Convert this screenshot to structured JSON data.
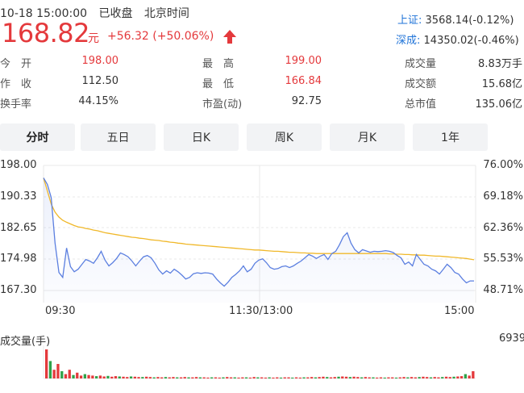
{
  "status": {
    "datetime": "10-18 15:00:00",
    "state": "已收盘",
    "tz": "北京时间"
  },
  "quote": {
    "price": "168.82",
    "unit": "元",
    "change": "+56.32 (+50.06%)"
  },
  "indices": [
    {
      "name": "上证:",
      "value": "3568.14(-0.12%)"
    },
    {
      "name": "深成:",
      "value": "14350.02(-0.46%)"
    }
  ],
  "stats": {
    "open_label": "今　开",
    "open": "198.00",
    "prev_label": "作　收",
    "prev": "112.50",
    "turnover_label": "换手率",
    "turnover": "44.15%",
    "high_label": "最　高",
    "high": "199.00",
    "low_label": "最　低",
    "low": "166.84",
    "pe_label": "市盈(动)",
    "pe": "92.75",
    "vol_label": "成交量",
    "vol": "8.83万手",
    "amount_label": "成交额",
    "amount": "15.68亿",
    "mcap_label": "总市值",
    "mcap": "135.06亿"
  },
  "tabs": [
    "分时",
    "五日",
    "日K",
    "周K",
    "月K",
    "1年"
  ],
  "colors": {
    "up": "#e4393c",
    "price_line": "#5b7fe0",
    "avg_line": "#f0b82a",
    "blue": "#1f73d8"
  },
  "chart_data": {
    "type": "line",
    "x_ticks": [
      "09:30",
      "11:30/13:00",
      "15:00"
    ],
    "y_ticks_left": [
      "198.00",
      "190.33",
      "182.65",
      "174.98",
      "167.30"
    ],
    "y_ticks_right": [
      "76.00%",
      "69.18%",
      "62.36%",
      "55.53%",
      "48.71%"
    ],
    "ylim": [
      163.46,
      201.84
    ],
    "series": [
      {
        "values": [
          198.0,
          196.0,
          192.0,
          178.0,
          169.0,
          167.5,
          176.5,
          170.8,
          169.2,
          170.0,
          171.5,
          173.0,
          172.5,
          171.8,
          173.5,
          175.5,
          172.8,
          171.0,
          172.0,
          173.3,
          175.0,
          174.5,
          173.8,
          172.5,
          171.0,
          172.5,
          173.8,
          174.2,
          173.5,
          171.8,
          169.8,
          168.5,
          169.5,
          168.8,
          170.0,
          169.2,
          168.2,
          167.0,
          167.5,
          168.6,
          168.9,
          168.7,
          168.9,
          168.8,
          168.5,
          167.0,
          165.8,
          164.8,
          166.0,
          167.5,
          168.4,
          169.5,
          171.0,
          169.2,
          170.0,
          171.8,
          172.8,
          173.2,
          172.0,
          170.5,
          170.0,
          170.2,
          170.8,
          171.0,
          170.5,
          171.0,
          171.8,
          172.5,
          173.5,
          174.5,
          174.0,
          173.3,
          174.0,
          174.5,
          173.0,
          174.8,
          175.5,
          177.5,
          180.0,
          181.2,
          178.0,
          176.0,
          175.0,
          176.0,
          175.6,
          175.2,
          175.5,
          175.4,
          175.5,
          175.7,
          175.5,
          175.1,
          174.2,
          173.5,
          171.5,
          172.2,
          171.0,
          174.5,
          173.0,
          171.5,
          171.0,
          170.0,
          169.5,
          168.5,
          170.0,
          171.5,
          170.5,
          169.0,
          168.5,
          167.0,
          165.8,
          166.4,
          166.4
        ]
      },
      {
        "values": [
          198.0,
          194.0,
          190.0,
          187.5,
          186.0,
          185.0,
          184.4,
          183.9,
          183.4,
          183.0,
          182.8,
          182.5,
          182.3,
          182.0,
          181.8,
          181.5,
          181.2,
          181.0,
          180.8,
          180.6,
          180.4,
          180.2,
          180.0,
          179.8,
          179.7,
          179.5,
          179.4,
          179.2,
          179.0,
          178.9,
          178.8,
          178.6,
          178.5,
          178.3,
          178.2,
          178.0,
          177.9,
          177.7,
          177.6,
          177.5,
          177.4,
          177.3,
          177.2,
          177.1,
          177.0,
          176.9,
          176.8,
          176.7,
          176.6,
          176.5,
          176.4,
          176.3,
          176.2,
          176.1,
          176.0,
          175.9,
          175.9,
          175.8,
          175.7,
          175.6,
          175.5,
          175.5,
          175.4,
          175.3,
          175.2,
          175.2,
          175.1,
          175.0,
          175.0,
          174.9,
          174.9,
          174.8,
          174.8,
          174.8,
          174.8,
          174.8,
          174.8,
          174.8,
          174.8,
          174.8,
          174.8,
          174.8,
          174.8,
          174.8,
          174.8,
          174.8,
          174.8,
          174.8,
          174.8,
          174.8,
          174.7,
          174.7,
          174.6,
          174.6,
          174.5,
          174.5,
          174.4,
          174.4,
          174.3,
          174.3,
          174.2,
          174.1,
          174.0,
          174.0,
          173.9,
          173.8,
          173.7,
          173.6,
          173.5,
          173.4,
          173.3,
          173.1,
          172.9
        ]
      }
    ],
    "volume_label": "成交量(手)",
    "volume_max": "6939",
    "volume_scale": [
      1.0,
      0.6,
      0.3,
      0.5,
      0.25,
      0.15,
      0.3,
      0.12,
      0.2,
      0.1,
      0.15,
      0.12,
      0.1,
      0.08,
      0.1,
      0.07,
      0.09,
      0.06,
      0.08,
      0.07,
      0.06,
      0.05,
      0.07,
      0.06,
      0.05,
      0.05,
      0.06,
      0.05,
      0.04,
      0.05,
      0.04,
      0.05,
      0.04,
      0.05,
      0.04,
      0.04,
      0.05,
      0.04,
      0.04,
      0.05,
      0.04,
      0.04,
      0.03,
      0.04,
      0.04,
      0.03,
      0.04,
      0.05,
      0.04,
      0.04,
      0.03,
      0.04,
      0.04,
      0.03,
      0.05,
      0.04,
      0.04,
      0.03,
      0.04,
      0.03,
      0.04,
      0.03,
      0.04,
      0.04,
      0.03,
      0.04,
      0.03,
      0.04,
      0.04,
      0.05,
      0.04,
      0.05,
      0.06,
      0.05,
      0.04,
      0.05,
      0.06,
      0.07,
      0.06,
      0.05,
      0.06,
      0.05,
      0.04,
      0.05,
      0.04,
      0.04,
      0.03,
      0.04,
      0.03,
      0.04,
      0.04,
      0.03,
      0.04,
      0.05,
      0.04,
      0.05,
      0.04,
      0.05,
      0.06,
      0.05,
      0.04,
      0.05,
      0.04,
      0.05,
      0.06,
      0.05,
      0.06,
      0.07,
      0.08,
      0.15,
      0.1,
      0.25
    ]
  }
}
